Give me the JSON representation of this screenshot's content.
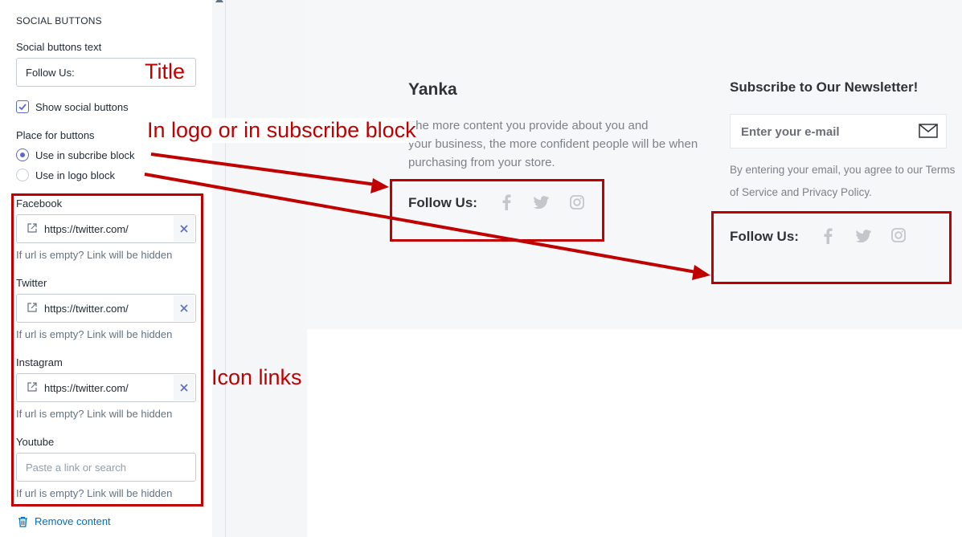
{
  "settings": {
    "section_title": "SOCIAL BUTTONS",
    "text_label": "Social buttons text",
    "text_value": "Follow Us:",
    "show_label": "Show social buttons",
    "place_label": "Place for buttons",
    "place_options": [
      "Use in subcribe block",
      "Use in logo block"
    ],
    "place_selected": "Use in subcribe block",
    "links": [
      {
        "label": "Facebook",
        "value": "https://twitter.com/"
      },
      {
        "label": "Twitter",
        "value": "https://twitter.com/"
      },
      {
        "label": "Instagram",
        "value": "https://twitter.com/"
      }
    ],
    "youtube": {
      "label": "Youtube",
      "placeholder": "Paste a link or search"
    },
    "hint": "If url is empty? Link will be hidden",
    "remove_label": "Remove content"
  },
  "preview": {
    "brand": "Yanka",
    "description_start": "The more content you provide about you and",
    "description_rest": "your business, the more confident people will be when purchasing from your store.",
    "follow_label": "Follow Us:",
    "newsletter_title": "Subscribe to Our Newsletter!",
    "email_placeholder": "Enter your e-mail",
    "agree_text": "By entering your email, you agree to our Terms of Service and Privacy Policy.",
    "icons": [
      "facebook-icon",
      "twitter-icon",
      "instagram-icon"
    ]
  },
  "annotations": {
    "title": "Title",
    "place": "In logo or in subscribe block",
    "icons": "Icon links"
  },
  "colors": {
    "accent": "#5c6ac4",
    "annotation": "#c00000",
    "link": "#006fbb"
  }
}
